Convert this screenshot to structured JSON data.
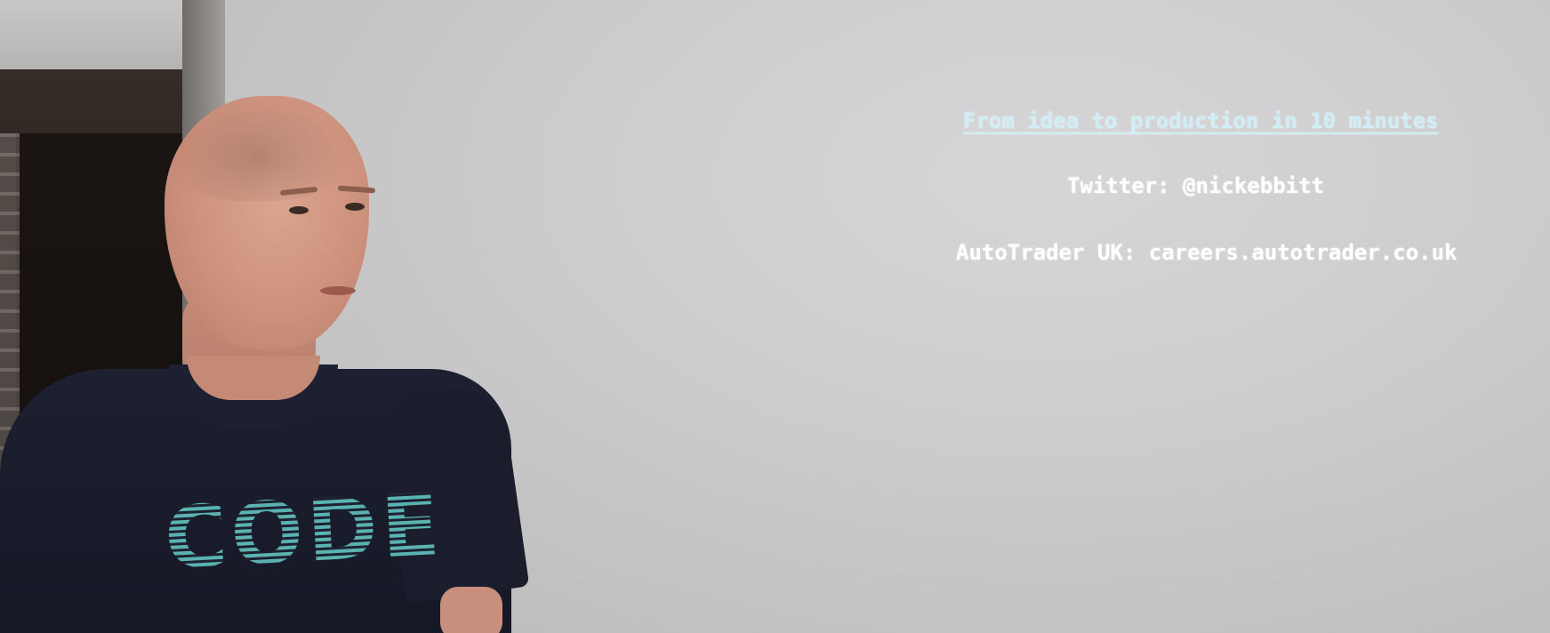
{
  "slide": {
    "title": "From idea to production in 10 minutes",
    "twitter": "Twitter: @nickebbitt",
    "careers": "AutoTrader UK: careers.autotrader.co.uk"
  },
  "presenter": {
    "shirt_text": "CODE"
  },
  "colors": {
    "screen": "#cfcecf",
    "title_text": "#cfeef6",
    "body_text": "#ffffff",
    "shirt": "#1d2030",
    "shirt_logo": "#5ab3b0"
  }
}
